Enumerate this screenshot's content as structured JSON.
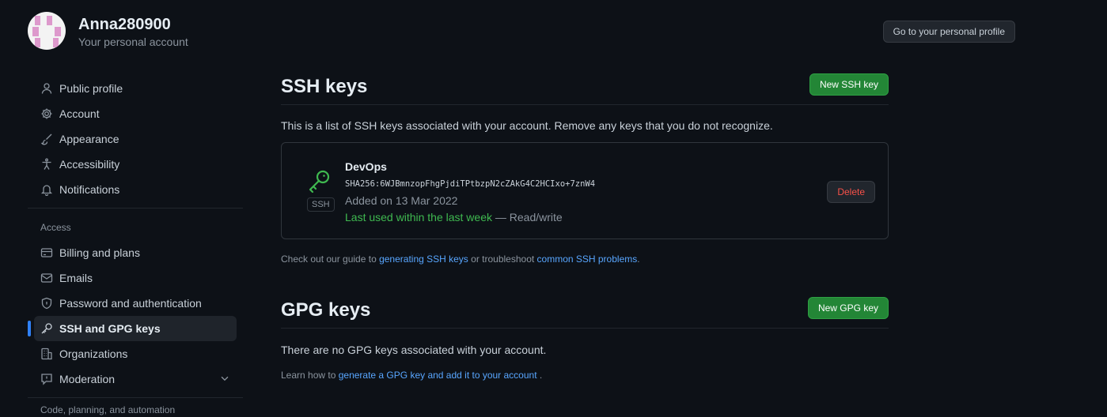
{
  "account": {
    "name": "Anna280900",
    "subtitle": "Your personal account",
    "profile_button": "Go to your personal profile"
  },
  "sidebar": {
    "items": [
      {
        "label": "Public profile",
        "icon": "person-icon"
      },
      {
        "label": "Account",
        "icon": "gear-icon"
      },
      {
        "label": "Appearance",
        "icon": "paintbrush-icon"
      },
      {
        "label": "Accessibility",
        "icon": "accessibility-icon"
      },
      {
        "label": "Notifications",
        "icon": "bell-icon"
      }
    ],
    "access_title": "Access",
    "access_items": [
      {
        "label": "Billing and plans",
        "icon": "credit-card-icon"
      },
      {
        "label": "Emails",
        "icon": "mail-icon"
      },
      {
        "label": "Password and authentication",
        "icon": "shield-lock-icon"
      },
      {
        "label": "SSH and GPG keys",
        "icon": "key-icon",
        "active": true
      },
      {
        "label": "Organizations",
        "icon": "organization-icon"
      },
      {
        "label": "Moderation",
        "icon": "report-icon"
      }
    ],
    "partial_label": "Code, planning, and automation"
  },
  "ssh": {
    "title": "SSH keys",
    "new_button": "New SSH key",
    "intro": "This is a list of SSH keys associated with your account. Remove any keys that you do not recognize.",
    "keys": [
      {
        "title": "DevOps",
        "fingerprint": "SHA256:6WJBmnzopFhgPjdiTPtbzpN2cZAkG4C2HCIxo+7znW4",
        "added": "Added on 13 Mar 2022",
        "last_used": "Last used within the last week",
        "access": " — Read/write",
        "type_label": "SSH",
        "delete_label": "Delete"
      }
    ],
    "note_prefix": "Check out our guide to ",
    "note_link1": "generating SSH keys",
    "note_mid": " or troubleshoot ",
    "note_link2": "common SSH problems",
    "note_suffix": "."
  },
  "gpg": {
    "title": "GPG keys",
    "new_button": "New GPG key",
    "intro": "There are no GPG keys associated with your account.",
    "note_prefix": "Learn how to ",
    "note_link": "generate a GPG key and add it to your account",
    "note_suffix": " ."
  },
  "colors": {
    "background": "#0d1117",
    "accent": "#2f81f7",
    "primary_button": "#238636",
    "danger": "#f85149",
    "success": "#3fb950",
    "link": "#58a6ff"
  }
}
